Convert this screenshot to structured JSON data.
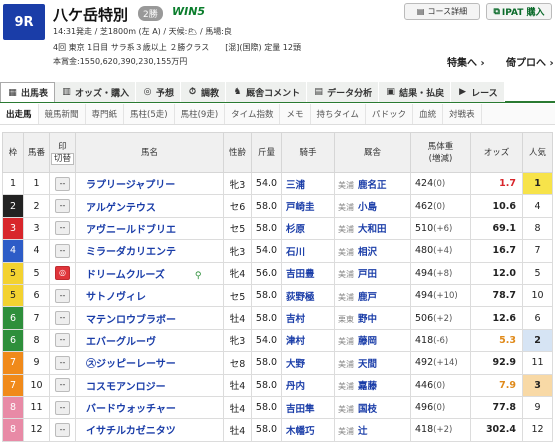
{
  "race": {
    "number": "9R",
    "name": "八ケ岳特別",
    "grade": "2勝",
    "win5": "WIN5",
    "line1": "14:31発走 / 芝1800m (左 A) / 天候:🌥 / 馬場:良",
    "line2": "4回 東京 1日目 サラ系３歳以上 ２勝クラス　　[混](国際) 定量 12頭",
    "line3": "本賞金:1550,620,390,230,155万円"
  },
  "header_buttons": {
    "course": "コース詳細",
    "ipat": "IPAT 購入"
  },
  "nav": {
    "special": "特集へ ›",
    "back": "倚プロへ ›"
  },
  "tabs": [
    "出馬表",
    "オッズ・購入",
    "予想",
    "調教",
    "厩舎コメント",
    "データ分析",
    "結果・払戻",
    "レース"
  ],
  "subtabs": [
    "出走馬",
    "競馬新聞",
    "専門紙",
    "馬柱(5走)",
    "馬柱(9走)",
    "タイム指数",
    "メモ",
    "持ちタイム",
    "パドック",
    "血統",
    "対戦表"
  ],
  "columns": {
    "waku": "枠",
    "umaban": "馬番",
    "mark": "印",
    "mark_sub": "切替",
    "horse": "馬名",
    "sexage": "性齢",
    "weight": "斤量",
    "jockey": "騎手",
    "trainer": "厩舎",
    "bodyweight": "馬体重",
    "bodyweight_sub": "(増減)",
    "odds": "オッズ",
    "popularity": "人気"
  },
  "rows": [
    {
      "waku": "1",
      "num": "1",
      "mark": "--",
      "horse": "ラプリージャプリー",
      "sex": "牝3",
      "kin": "54.0",
      "jockey": "三浦",
      "region": "美浦",
      "trainer": "鹿名正",
      "weight": "424",
      "diff": "(0)",
      "odds": "1.7",
      "pop": "1"
    },
    {
      "waku": "2",
      "num": "2",
      "mark": "--",
      "horse": "アルゲンテウス",
      "sex": "セ6",
      "kin": "58.0",
      "jockey": "戸崎圭",
      "region": "美浦",
      "trainer": "小島",
      "weight": "462",
      "diff": "(0)",
      "odds": "10.6",
      "pop": "4"
    },
    {
      "waku": "3",
      "num": "3",
      "mark": "--",
      "horse": "アヴニールドブリエ",
      "sex": "セ5",
      "kin": "58.0",
      "jockey": "杉原",
      "region": "美浦",
      "trainer": "大和田",
      "weight": "510",
      "diff": "(+6)",
      "odds": "69.1",
      "pop": "8"
    },
    {
      "waku": "4",
      "num": "4",
      "mark": "--",
      "horse": "ミラーダカリエンテ",
      "sex": "牝3",
      "kin": "54.0",
      "jockey": "石川",
      "region": "美浦",
      "trainer": "相沢",
      "weight": "480",
      "diff": "(+4)",
      "odds": "16.7",
      "pop": "7"
    },
    {
      "waku": "5",
      "num": "5",
      "mark": "◎",
      "horse": "ドリームクルーズ",
      "sex": "牝4",
      "kin": "56.0",
      "jockey": "吉田豊",
      "region": "美浦",
      "trainer": "戸田",
      "weight": "494",
      "diff": "(+8)",
      "odds": "12.0",
      "pop": "5"
    },
    {
      "waku": "5",
      "num": "6",
      "mark": "--",
      "horse": "サトノヴィレ",
      "sex": "セ5",
      "kin": "58.0",
      "jockey": "荻野極",
      "region": "美浦",
      "trainer": "鹿戸",
      "weight": "494",
      "diff": "(+10)",
      "odds": "78.7",
      "pop": "10"
    },
    {
      "waku": "6",
      "num": "7",
      "mark": "--",
      "horse": "マテンロウブラボー",
      "sex": "牡4",
      "kin": "58.0",
      "jockey": "吉村",
      "region": "栗東",
      "trainer": "野中",
      "weight": "506",
      "diff": "(+2)",
      "odds": "12.6",
      "pop": "6"
    },
    {
      "waku": "6",
      "num": "8",
      "mark": "--",
      "horse": "エバーグルーヴ",
      "sex": "牝3",
      "kin": "54.0",
      "jockey": "津村",
      "region": "美浦",
      "trainer": "藤岡",
      "weight": "418",
      "diff": "(-6)",
      "odds": "5.3",
      "pop": "2"
    },
    {
      "waku": "7",
      "num": "9",
      "mark": "--",
      "horse": "㋜ジッピーレーサー",
      "sex": "セ8",
      "kin": "58.0",
      "jockey": "大野",
      "region": "美浦",
      "trainer": "天間",
      "weight": "492",
      "diff": "(+14)",
      "odds": "92.9",
      "pop": "11"
    },
    {
      "waku": "7",
      "num": "10",
      "mark": "--",
      "horse": "コスモアンロジー",
      "sex": "牡4",
      "kin": "58.0",
      "jockey": "丹内",
      "region": "美浦",
      "trainer": "嘉藤",
      "weight": "446",
      "diff": "(0)",
      "odds": "7.9",
      "pop": "3"
    },
    {
      "waku": "8",
      "num": "11",
      "mark": "--",
      "horse": "バードウォッチャー",
      "sex": "牡4",
      "kin": "58.0",
      "jockey": "吉田隼",
      "region": "美浦",
      "trainer": "国枝",
      "weight": "496",
      "diff": "(0)",
      "odds": "77.8",
      "pop": "9"
    },
    {
      "waku": "8",
      "num": "12",
      "mark": "--",
      "horse": "イサチルカゼニタツ",
      "sex": "牡4",
      "kin": "58.0",
      "jockey": "木幡巧",
      "region": "美浦",
      "trainer": "辻",
      "weight": "418",
      "diff": "(+2)",
      "odds": "302.4",
      "pop": "12"
    }
  ],
  "colors": {
    "accent": "#2a7a32",
    "race_badge": "#1a3da8",
    "link": "#1a3da8",
    "odds_low": "#d8262b",
    "odds_mid": "#e08a1a"
  }
}
